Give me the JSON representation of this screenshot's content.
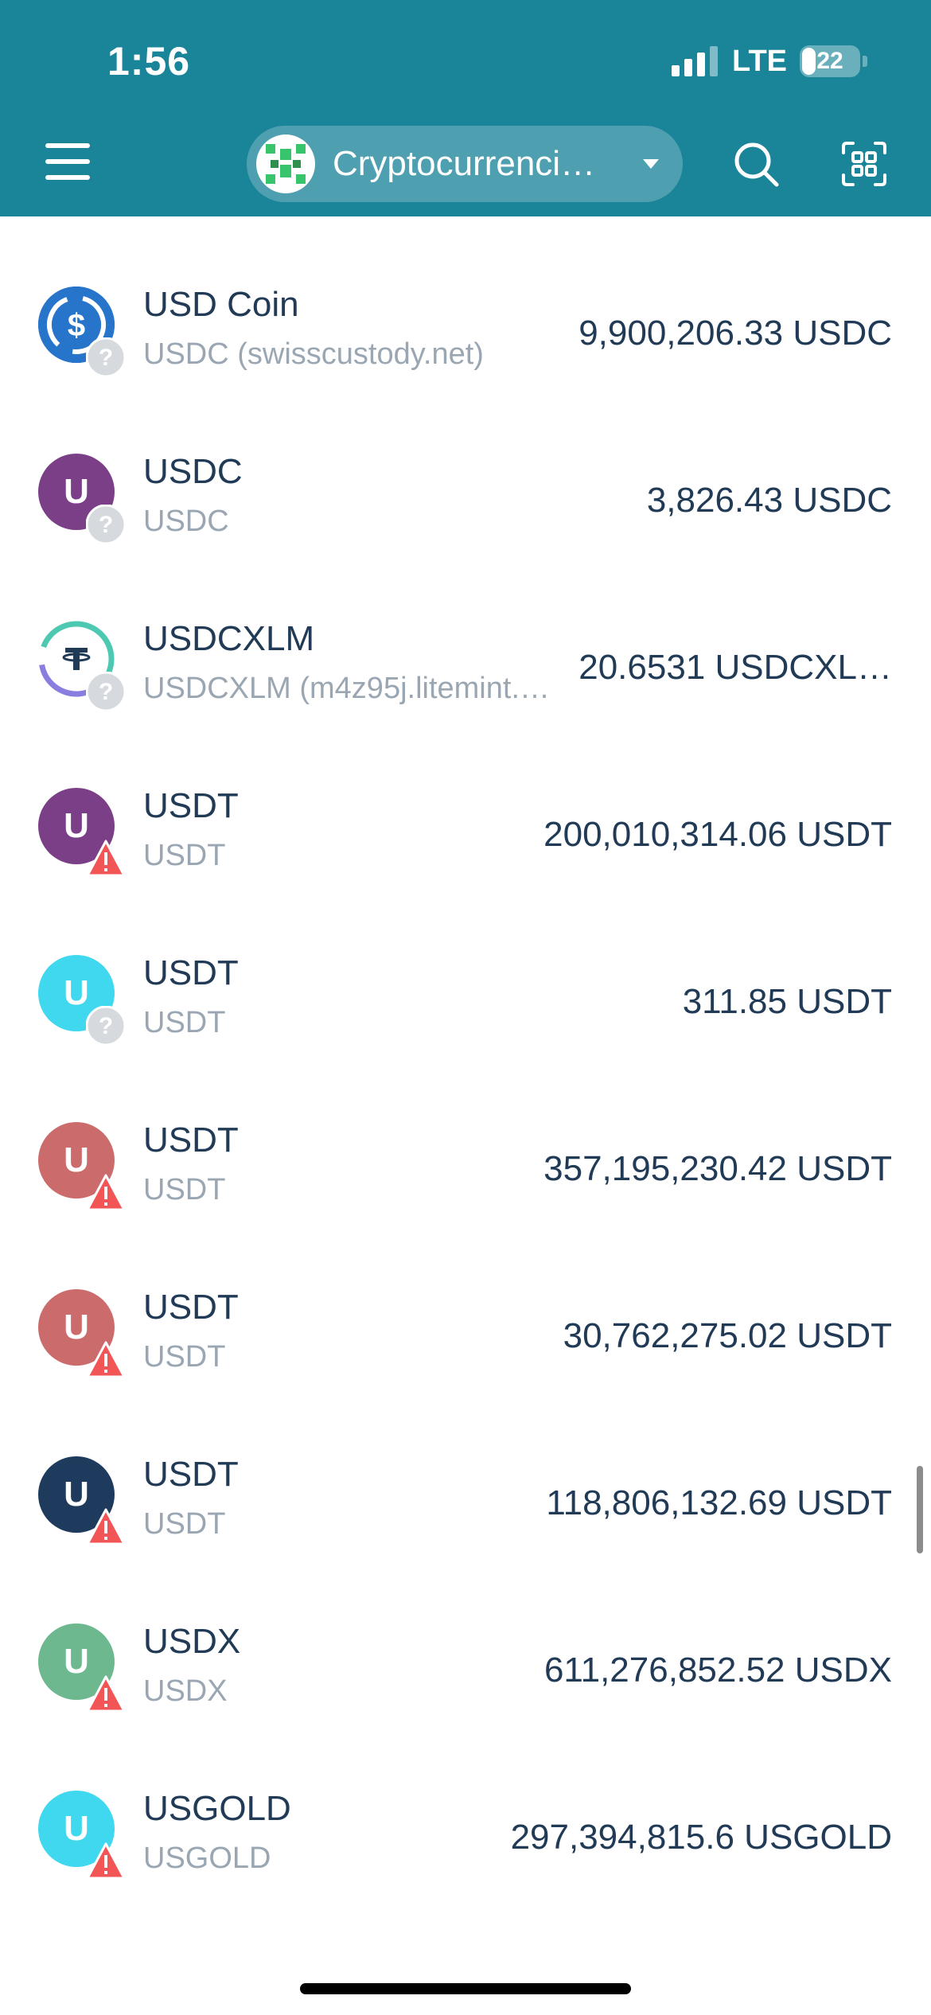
{
  "status": {
    "time": "1:56",
    "network": "LTE",
    "battery": "22"
  },
  "header": {
    "network_title": "Cryptocurrenci…"
  },
  "assets": [
    {
      "name": "USD Coin",
      "code": "USDC (swisscustody.net)",
      "amount": "9,900,206.33 USDC",
      "avatar_letter": "",
      "avatar_icon": "usdc-logo-icon",
      "avatar_color": "#2775ca",
      "badge": "unknown"
    },
    {
      "name": "USDC",
      "code": "USDC",
      "amount": "3,826.43 USDC",
      "avatar_letter": "U",
      "avatar_color": "#7a3f86",
      "badge": "unknown"
    },
    {
      "name": "USDCXLM",
      "code": "USDCXLM (m4z95j.litemint.…",
      "amount": "20.6531 USDCXL…",
      "avatar_letter": "",
      "avatar_icon": "tether-logo-icon",
      "avatar_color": "#ffffff",
      "badge": "unknown"
    },
    {
      "name": "USDT",
      "code": "USDT",
      "amount": "200,010,314.06 USDT",
      "avatar_letter": "U",
      "avatar_color": "#7a3f86",
      "badge": "warning"
    },
    {
      "name": "USDT",
      "code": "USDT",
      "amount": "311.85 USDT",
      "avatar_letter": "U",
      "avatar_color": "#3fd8ee",
      "badge": "unknown"
    },
    {
      "name": "USDT",
      "code": "USDT",
      "amount": "357,195,230.42 USDT",
      "avatar_letter": "U",
      "avatar_color": "#cc6b6b",
      "badge": "warning"
    },
    {
      "name": "USDT",
      "code": "USDT",
      "amount": "30,762,275.02 USDT",
      "avatar_letter": "U",
      "avatar_color": "#cc6b6b",
      "badge": "warning"
    },
    {
      "name": "USDT",
      "code": "USDT",
      "amount": "118,806,132.69 USDT",
      "avatar_letter": "U",
      "avatar_color": "#1e3a5c",
      "badge": "warning"
    },
    {
      "name": "USDX",
      "code": "USDX",
      "amount": "611,276,852.52 USDX",
      "avatar_letter": "U",
      "avatar_color": "#6db88f",
      "badge": "warning"
    },
    {
      "name": "USGOLD",
      "code": "USGOLD",
      "amount": "297,394,815.6 USGOLD",
      "avatar_letter": "U",
      "avatar_color": "#3fd8ee",
      "badge": "warning"
    }
  ],
  "colors": {
    "header_bg": "#1a8499",
    "text_primary": "#213a56",
    "text_secondary": "#9aa7b3",
    "warning": "#f25555",
    "unknown_badge": "#d6d9dd"
  }
}
